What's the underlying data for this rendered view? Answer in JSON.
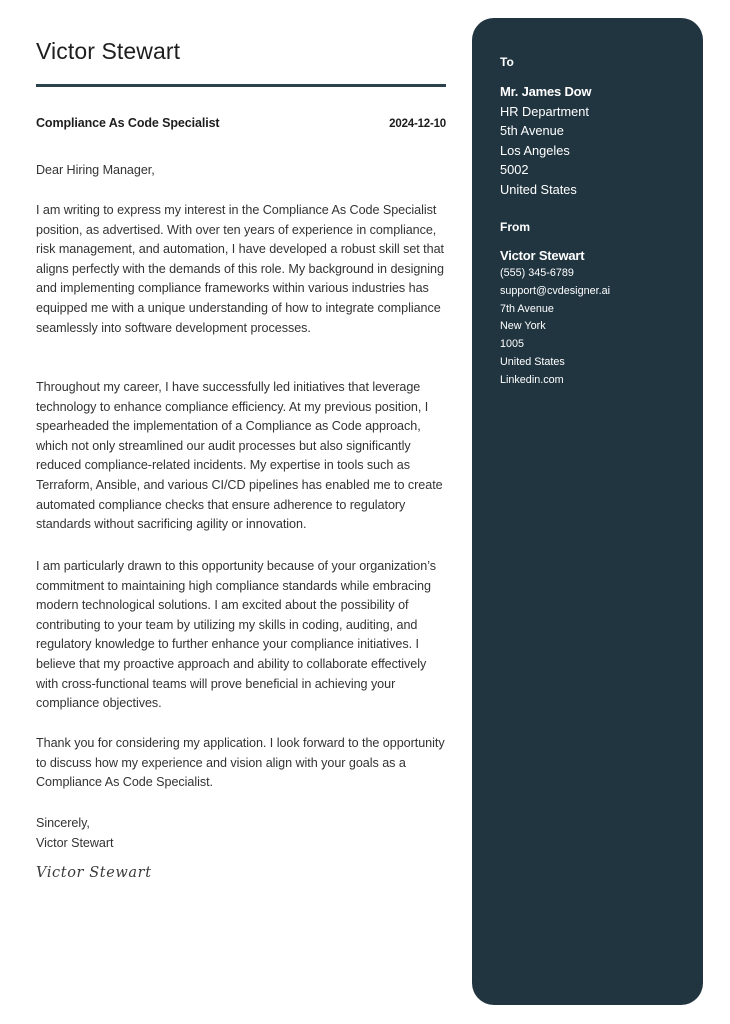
{
  "header": {
    "name": "Victor Stewart",
    "job_title": "Compliance As Code Specialist",
    "date": "2024-12-10"
  },
  "letter": {
    "greeting": "Dear Hiring Manager,",
    "paragraphs": [
      "I am writing to express my interest in the Compliance As Code Specialist position, as advertised. With over ten years of experience in compliance, risk management, and automation, I have developed a robust skill set that aligns perfectly with the demands of this role. My background in designing and implementing compliance frameworks within various industries has equipped me with a unique understanding of how to integrate compliance seamlessly into software development processes.",
      "Throughout my career, I have successfully led initiatives that leverage technology to enhance compliance efficiency. At my previous position, I spearheaded the implementation of a Compliance as Code approach, which not only streamlined our audit processes but also significantly reduced compliance-related incidents. My expertise in tools such as Terraform, Ansible, and various CI/CD pipelines has enabled me to create automated compliance checks that ensure adherence to regulatory standards without sacrificing agility or innovation.",
      "I am particularly drawn to this opportunity because of your organization’s commitment to maintaining high compliance standards while embracing modern technological solutions. I am excited about the possibility of contributing to your team by utilizing my skills in coding, auditing, and regulatory knowledge to further enhance your compliance initiatives. I believe that my proactive approach and ability to collaborate effectively with cross-functional teams will prove beneficial in achieving your compliance objectives.",
      "Thank you for considering my application. I look forward to the opportunity to discuss how my experience and vision align with your goals as a Compliance As Code Specialist."
    ],
    "closing": "Sincerely,",
    "closing_name": "Victor Stewart",
    "signature": "Victor Stewart"
  },
  "sidebar": {
    "colors": {
      "background": "#213540",
      "text": "#ffffff"
    },
    "to": {
      "heading": "To",
      "name": "Mr. James Dow",
      "lines": [
        "HR Department",
        "5th Avenue",
        "Los Angeles",
        "5002",
        "United States"
      ]
    },
    "from": {
      "heading": "From",
      "name": "Victor Stewart",
      "lines": [
        "(555) 345-6789",
        "support@cvdesigner.ai",
        "7th Avenue",
        "New York",
        "1005",
        "United States",
        "Linkedin.com"
      ]
    }
  },
  "colors": {
    "accent": "#2b424d",
    "text": "#333333"
  }
}
